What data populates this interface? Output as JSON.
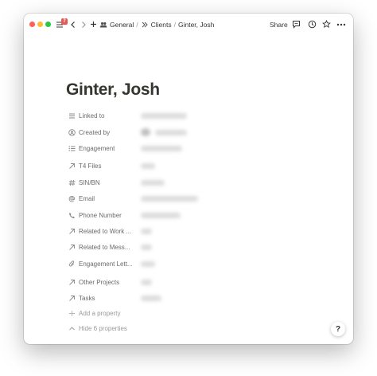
{
  "titlebar": {
    "notification_count": "7",
    "breadcrumbs": [
      "General",
      "Clients",
      "Ginter, Josh"
    ],
    "share_label": "Share"
  },
  "page": {
    "title": "Ginter, Josh"
  },
  "properties": [
    {
      "label": "Linked to",
      "icon": "lines-icon"
    },
    {
      "label": "Created by",
      "icon": "person-circle-icon"
    },
    {
      "label": "Engagement",
      "icon": "bulleted-list-icon"
    },
    {
      "label": "T4 Files",
      "icon": "arrow-up-right-icon"
    },
    {
      "label": "SIN/BN",
      "icon": "hash-icon"
    },
    {
      "label": "Email",
      "icon": "at-icon"
    },
    {
      "label": "Phone Number",
      "icon": "phone-icon"
    },
    {
      "label": "Related to Work ...",
      "icon": "arrow-up-right-icon"
    },
    {
      "label": "Related to Mess...",
      "icon": "arrow-up-right-icon"
    },
    {
      "label": "Engagement Lett...",
      "icon": "paperclip-icon"
    },
    {
      "label": "Other Projects",
      "icon": "arrow-up-right-icon"
    },
    {
      "label": "Tasks",
      "icon": "arrow-up-right-icon"
    }
  ],
  "footer": {
    "add_property": "Add a property",
    "hide_properties": "Hide 6 properties"
  },
  "help_label": "?"
}
